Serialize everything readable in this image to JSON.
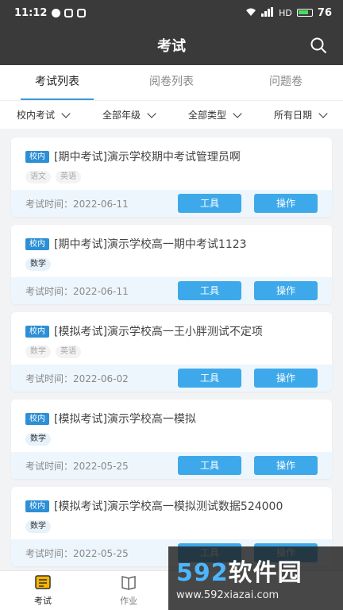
{
  "status": {
    "time": "11:12",
    "network": "HD",
    "battery": "76"
  },
  "header": {
    "title": "考试"
  },
  "tabs": [
    {
      "label": "考试列表",
      "active": true
    },
    {
      "label": "阅卷列表",
      "active": false
    },
    {
      "label": "问题卷",
      "active": false
    }
  ],
  "filters": [
    {
      "label": "校内考试"
    },
    {
      "label": "全部年级"
    },
    {
      "label": "全部类型"
    },
    {
      "label": "所有日期"
    }
  ],
  "exams": [
    {
      "badge": "校内",
      "title": "[期中考试]演示学校期中考试管理员啊",
      "tags": [
        "语文",
        "英语"
      ],
      "tag_active": false,
      "date": "考试时间：2022-06-11",
      "tool": "工具",
      "op": "操作"
    },
    {
      "badge": "校内",
      "title": "[期中考试]演示学校高一期中考试1123",
      "tags": [
        "数学"
      ],
      "tag_active": true,
      "date": "考试时间：2022-06-11",
      "tool": "工具",
      "op": "操作"
    },
    {
      "badge": "校内",
      "title": "[模拟考试]演示学校高一王小胖测试不定项",
      "tags": [
        "数学",
        "英语"
      ],
      "tag_active": false,
      "date": "考试时间：2022-06-02",
      "tool": "工具",
      "op": "操作"
    },
    {
      "badge": "校内",
      "title": "[模拟考试]演示学校高一模拟",
      "tags": [
        "数学"
      ],
      "tag_active": true,
      "date": "考试时间：2022-05-25",
      "tool": "工具",
      "op": "操作"
    },
    {
      "badge": "校内",
      "title": "[模拟考试]演示学校高一模拟测试数据524000",
      "tags": [
        "数学"
      ],
      "tag_active": true,
      "date": "考试时间：2022-05-25",
      "tool": "工具",
      "op": "操作"
    }
  ],
  "tabbar": [
    {
      "label": "考试",
      "icon": "exam-icon",
      "active": true
    },
    {
      "label": "作业",
      "icon": "homework-icon",
      "active": false
    }
  ],
  "watermark": {
    "brand_num": "592",
    "brand_text": "软件园",
    "url": "www.592xiazai.com"
  },
  "colors": {
    "accent": "#3ea9ea",
    "header": "#3a3a3a",
    "badge": "#2d8fd5"
  }
}
